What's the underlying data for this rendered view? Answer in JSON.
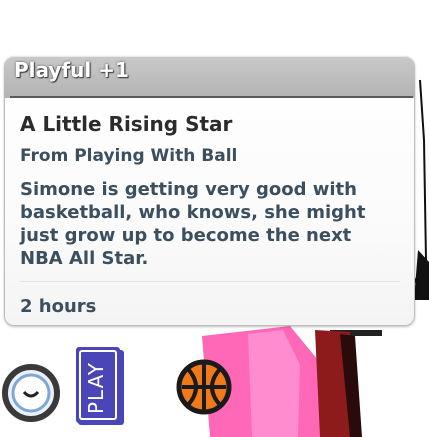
{
  "trait": {
    "label": "Playful +1"
  },
  "moodlet": {
    "title": "A Little Rising Star",
    "source": "From Playing With Ball",
    "description": "Simone is getting very good with basketball, who knows, she might just grow up to become the next NBA All Star.",
    "duration": "2 hours"
  },
  "bottom_bar": {
    "sign_text": "PLAY"
  },
  "colors": {
    "header": "#b9b9b9",
    "text_dark": "#2b2b2b",
    "text_blue": "#3b4f5f",
    "ball": "#f07a1a",
    "pink_shirt": "#ff66b5",
    "dark_red": "#8f1a1a"
  },
  "icons": {
    "moodlet": "smiley-moodlet-icon",
    "sign": "playground-sign-icon",
    "ball": "basketball-icon"
  }
}
